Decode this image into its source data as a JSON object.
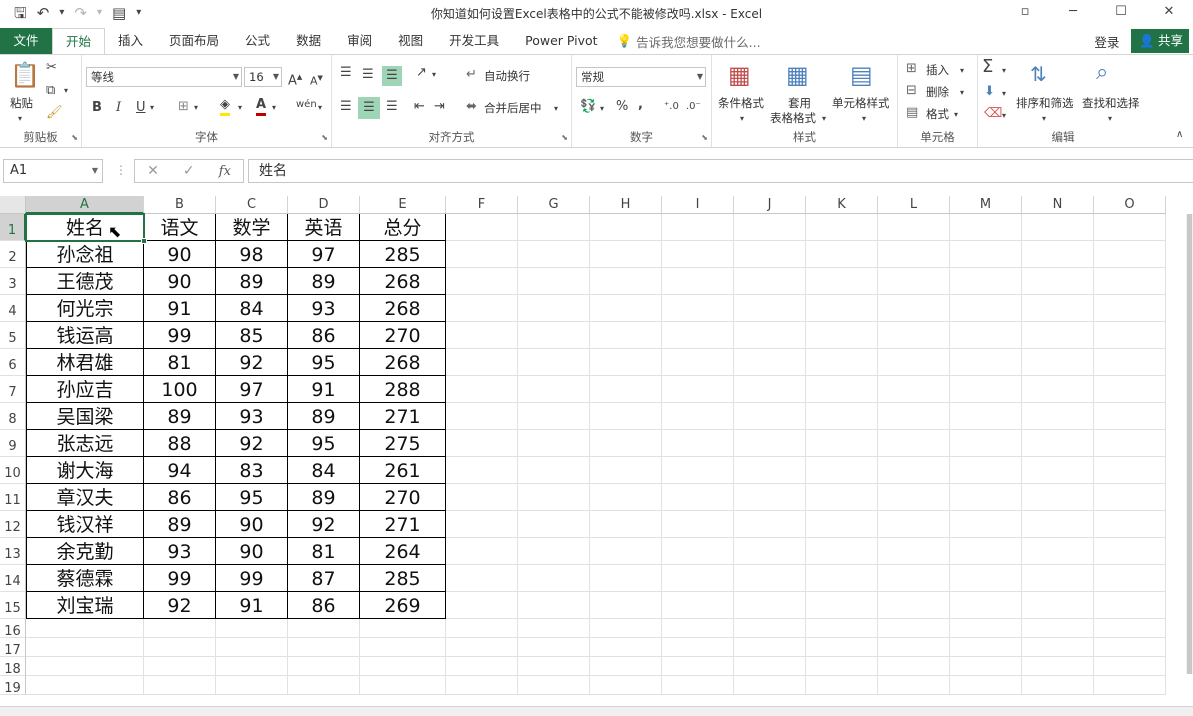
{
  "window": {
    "title": "你知道如何设置Excel表格中的公式不能被修改吗.xlsx - Excel",
    "restore_icon": "▫",
    "minimize": "─",
    "maximize": "☐",
    "close": "✕"
  },
  "qat": {
    "save": "🖫",
    "undo": "↶",
    "redo": "↷",
    "form": "▤",
    "more": "▾"
  },
  "tabs": {
    "file": "文件",
    "items": [
      "开始",
      "插入",
      "页面布局",
      "公式",
      "数据",
      "审阅",
      "视图",
      "开发工具",
      "Power Pivot"
    ],
    "active": "开始",
    "tellme": "告诉我您想要做什么...",
    "login": "登录",
    "share": "共享"
  },
  "ribbon": {
    "clipboard": {
      "paste": "粘贴",
      "label": "剪贴板"
    },
    "font": {
      "name": "等线",
      "size": "16",
      "label": "字体",
      "bold": "B",
      "italic": "I",
      "underline": "U"
    },
    "alignment": {
      "wrap": "自动换行",
      "merge": "合并后居中",
      "label": "对齐方式"
    },
    "number": {
      "format": "常规",
      "percent": "%",
      "comma": ",",
      "label": "数字"
    },
    "styles": {
      "conditional": "条件格式",
      "table": "套用",
      "table2": "表格格式",
      "cell": "单元格样式",
      "label": "样式"
    },
    "cells": {
      "insert": "插入",
      "delete": "删除",
      "format": "格式",
      "label": "单元格"
    },
    "editing": {
      "sort": "排序和筛选",
      "find": "查找和选择",
      "label": "编辑"
    }
  },
  "formula_bar": {
    "name_box": "A1",
    "content": "姓名",
    "cancel": "✕",
    "enter": "✓",
    "fx": "fx"
  },
  "sheet": {
    "columns": [
      "A",
      "B",
      "C",
      "D",
      "E",
      "F",
      "G",
      "H",
      "I",
      "J",
      "K",
      "L",
      "M",
      "N",
      "O"
    ],
    "row_count": 19,
    "selected_cell": "A1",
    "header": [
      "姓名",
      "语文",
      "数学",
      "英语",
      "总分"
    ],
    "rows": [
      [
        "孙念祖",
        "90",
        "98",
        "97",
        "285"
      ],
      [
        "王德茂",
        "90",
        "89",
        "89",
        "268"
      ],
      [
        "何光宗",
        "91",
        "84",
        "93",
        "268"
      ],
      [
        "钱运高",
        "99",
        "85",
        "86",
        "270"
      ],
      [
        "林君雄",
        "81",
        "92",
        "95",
        "268"
      ],
      [
        "孙应吉",
        "100",
        "97",
        "91",
        "288"
      ],
      [
        "吴国梁",
        "89",
        "93",
        "89",
        "271"
      ],
      [
        "张志远",
        "88",
        "92",
        "95",
        "275"
      ],
      [
        "谢大海",
        "94",
        "83",
        "84",
        "261"
      ],
      [
        "章汉夫",
        "86",
        "95",
        "89",
        "270"
      ],
      [
        "钱汉祥",
        "89",
        "90",
        "92",
        "271"
      ],
      [
        "余克勤",
        "93",
        "90",
        "81",
        "264"
      ],
      [
        "蔡德霖",
        "99",
        "99",
        "87",
        "285"
      ],
      [
        "刘宝瑞",
        "92",
        "91",
        "86",
        "269"
      ]
    ]
  },
  "colors": {
    "accent": "#217346",
    "selected_header": "#d2d2d2"
  }
}
